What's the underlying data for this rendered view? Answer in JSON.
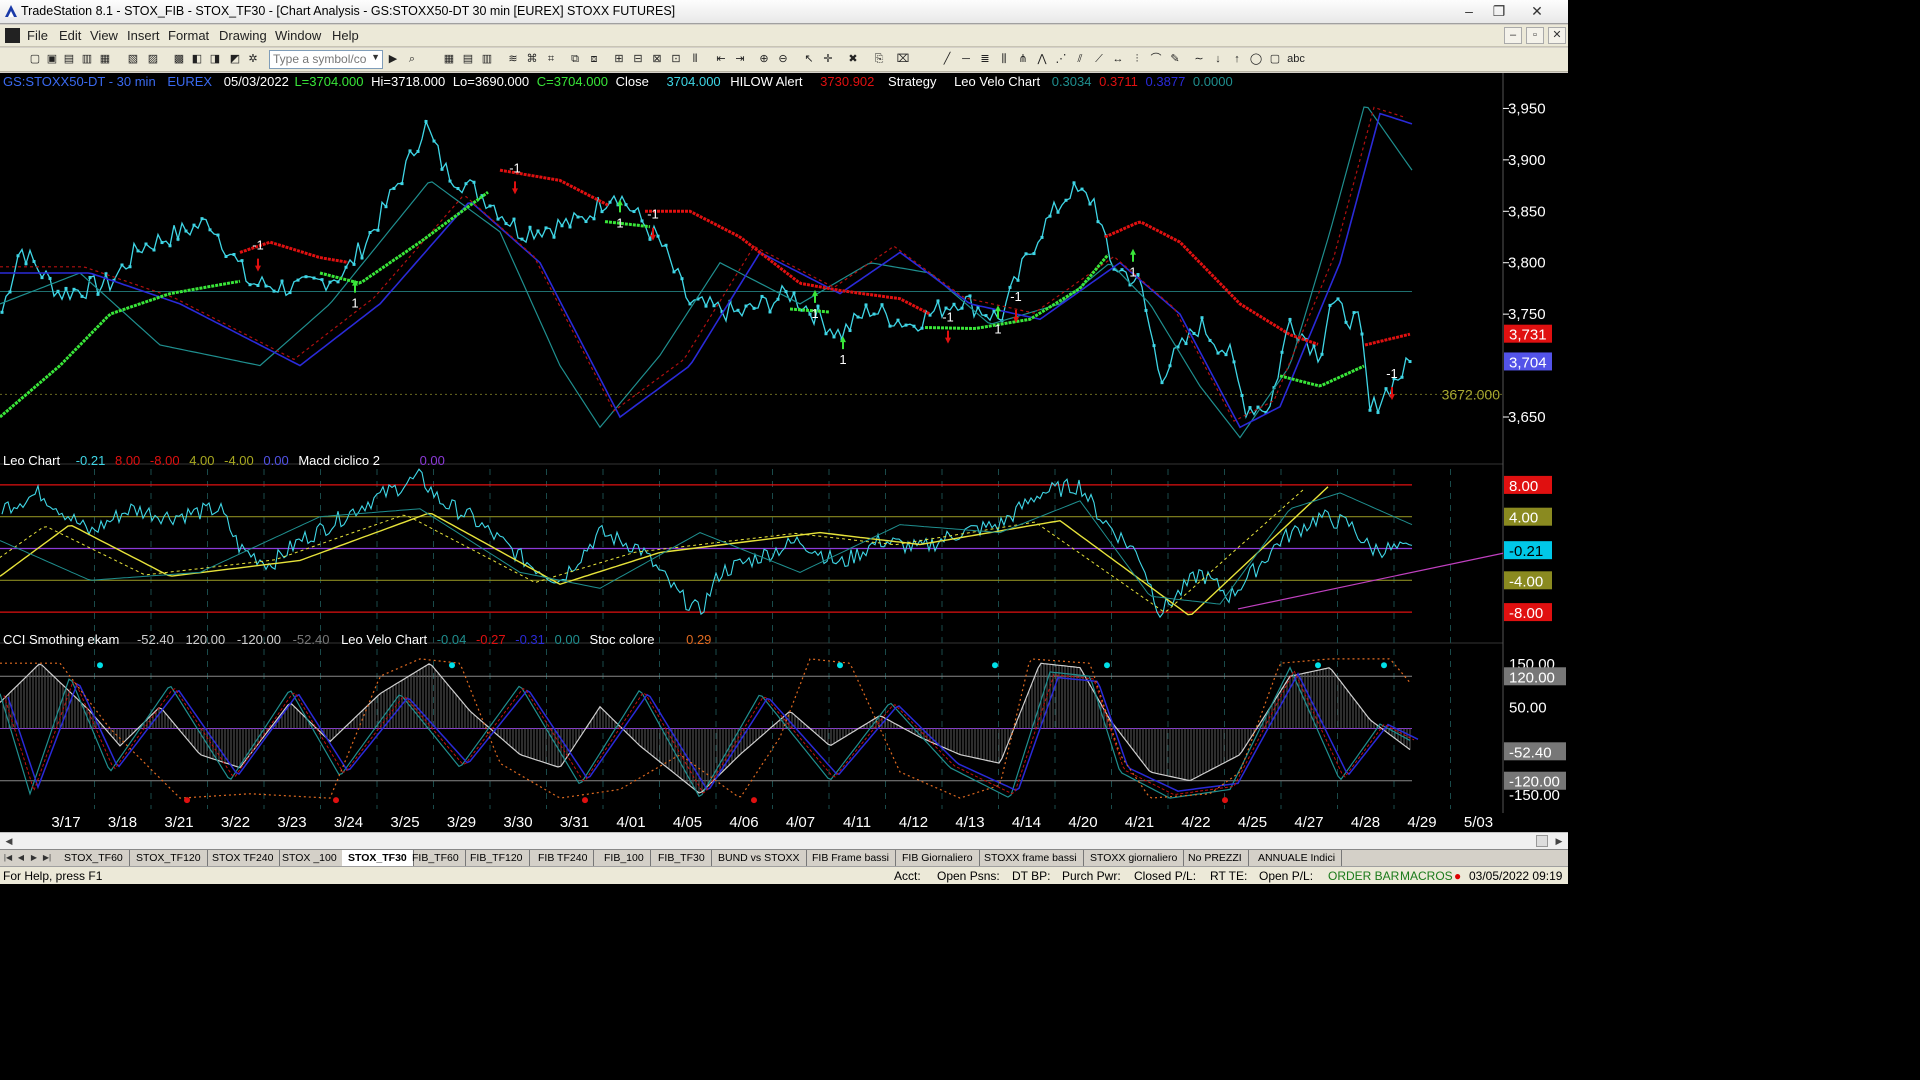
{
  "window": {
    "title": "TradeStation 8.1 - STOX_FIB - STOX_TF30 - [Chart Analysis - GS:STOXX50-DT  30 min  [EUREX] STOXX FUTURES]",
    "minimize": "–",
    "maximize": "❐",
    "close": "✕"
  },
  "menu": [
    "File",
    "Edit",
    "View",
    "Insert",
    "Format",
    "Drawing",
    "Window",
    "Help"
  ],
  "mdi_buttons": [
    "–",
    "▫",
    "✕"
  ],
  "toolbar": {
    "symbol_placeholder": "Type a symbol/co",
    "icons_left": [
      "new-icon",
      "open-icon",
      "save-icon",
      "save-all-icon",
      "print-icon",
      "print-preview-icon",
      "lock-icon",
      "gear-icon"
    ],
    "icons_right": [
      "grid-icon",
      "layout-icon",
      "table-icon",
      "chart-icon",
      "window-icon",
      "zoom-in-icon",
      "zoom-out-icon",
      "cursor-icon",
      "crosshair-icon",
      "trendline-icon",
      "fib-icon",
      "text-icon"
    ]
  },
  "chart_header": {
    "symbol": "GS:STOXX50-DT - 30 min",
    "exchange": "EUREX",
    "date": "05/03/2022",
    "last": "L=3704.000",
    "hi": "Hi=3718.000",
    "lo": "Lo=3690.000",
    "close_val": "C=3704.000",
    "close_label": "Close",
    "close_num": "3704.000",
    "hilow_label": "HILOW Alert",
    "hilow_val": "3730.902",
    "strategy": "Strategy",
    "leo_velo_label": "Leo Velo Chart",
    "leo_velo_vals": [
      "0.3034",
      "0.3711",
      "0.3877",
      "0.0000"
    ]
  },
  "sub1_header": {
    "name": "Leo Chart",
    "vals": [
      "-0.21",
      "8.00",
      "-8.00",
      "4.00",
      "-4.00",
      "0.00"
    ],
    "macd_label": "Macd ciclico 2",
    "macd_val": "0.00"
  },
  "sub2_header": {
    "cci_label": "CCI Smothing ekam",
    "cci_vals": [
      "-52.40",
      "120.00",
      "-120.00",
      "-52.40"
    ],
    "leo_label": "Leo Velo Chart",
    "leo_vals": [
      "-0.04",
      "-0.27",
      "-0.31",
      "0.00"
    ],
    "stoc_label": "Stoc colore",
    "stoc_val": "0.29"
  },
  "price_axis": {
    "ticks": [
      "3,950",
      "3,900",
      "3,850",
      "3,800",
      "3,750",
      "3,650"
    ],
    "tick_values": [
      3950,
      3900,
      3850,
      3800,
      3750,
      3650
    ],
    "badge_red": "3,731",
    "badge_blue": "3,704",
    "hline_label": "3672.000"
  },
  "sub1_axis": {
    "badges": [
      "8.00",
      "4.00",
      "-0.21",
      "-4.00",
      "-8.00"
    ],
    "badge_values": [
      8,
      4,
      -0.21,
      -4,
      -8
    ]
  },
  "sub2_axis": {
    "ticks": [
      "150.00",
      "120.00",
      "50.00",
      "-52.40",
      "-120.00",
      "-150.00"
    ],
    "tick_values": [
      150,
      120,
      50,
      -52.4,
      -120,
      -150
    ]
  },
  "date_axis": [
    "3/17",
    "3/18",
    "3/21",
    "3/22",
    "3/23",
    "3/24",
    "3/25",
    "3/29",
    "3/30",
    "3/31",
    "4/01",
    "4/05",
    "4/06",
    "4/07",
    "4/11",
    "4/12",
    "4/13",
    "4/14",
    "4/20",
    "4/21",
    "4/22",
    "4/25",
    "4/27",
    "4/28",
    "4/29",
    "5/03"
  ],
  "signals": [
    {
      "label": "-1",
      "dir": "down"
    },
    {
      "label": "1",
      "dir": "up"
    },
    {
      "label": "-1",
      "dir": "down"
    },
    {
      "label": "1",
      "dir": "up"
    },
    {
      "label": "-1",
      "dir": "down"
    },
    {
      "label": "1",
      "dir": "up"
    },
    {
      "label": "1",
      "dir": "up"
    },
    {
      "label": "-1",
      "dir": "down"
    },
    {
      "label": "1",
      "dir": "up"
    },
    {
      "label": "-1",
      "dir": "down"
    },
    {
      "label": "1",
      "dir": "up"
    },
    {
      "label": "-1",
      "dir": "down"
    }
  ],
  "colors": {
    "price": "#3fd6e6",
    "ma_up": "#39e639",
    "ma_down": "#e01010",
    "teal": "#1f8f8f",
    "navy": "#2a2ad8",
    "badge_red": "#e01010",
    "badge_blue": "#5353e8",
    "yellow": "#e6e23a",
    "magenta": "#c040c0",
    "olive": "#8a8a20",
    "purple": "#8c3ad8",
    "orange": "#e06a20",
    "gray": "#cfcfcf"
  },
  "sheet_tabs": [
    "STOX_TF60",
    "STOX_TF120",
    "STOX TF240",
    "STOX _100",
    "STOX_TF30",
    "FIB_TF60",
    "FIB_TF120",
    "FIB TF240",
    "FIB_100",
    "FIB_TF30",
    "BUND vs STOXX",
    "FIB Frame bassi",
    "FIB Giornaliero",
    "STOXX frame bassi",
    "STOXX giornaliero",
    "No PREZZI",
    "ANNUALE Indici"
  ],
  "active_tab": "STOX_TF30",
  "status": {
    "help": "For Help, press F1",
    "acct": "Acct:",
    "open_psns": "Open Psns:",
    "dt_bp": "DT BP:",
    "purch_pwr": "Purch Pwr:",
    "closed_pl": "Closed P/L:",
    "rt_te": "RT TE:",
    "open_pl": "Open P/L:",
    "order_bar": "ORDER BAR",
    "macros": "MACROS",
    "datetime": "03/05/2022 09:19"
  }
}
